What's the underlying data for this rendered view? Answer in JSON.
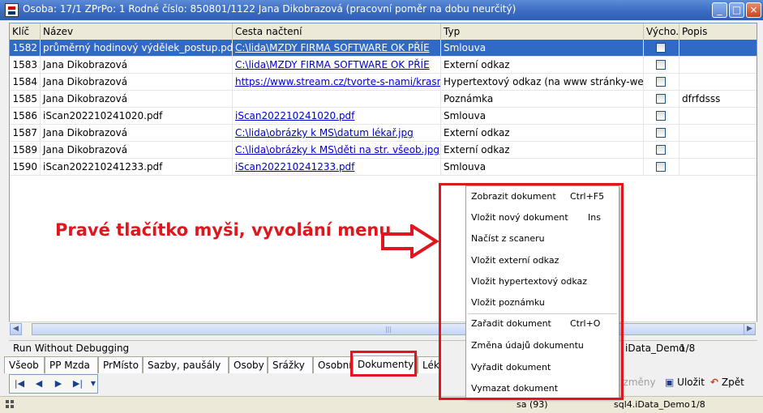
{
  "window": {
    "title": "Osoba: 17/1   ZPrPo: 1   Rodné číslo: 850801/1122   Jana Dikobrazová   (pracovní poměr na dobu neurčitý)",
    "minimize": "_",
    "maximize": "□",
    "close": "×"
  },
  "grid": {
    "columns": [
      "Klíč",
      "Název",
      "Cesta načtení",
      "Typ",
      "Výcho.",
      "Popis"
    ],
    "rows": [
      {
        "key": "1582",
        "name": "průměrný hodinový výdělek_postup.pdf",
        "path": "C:\\lida\\MZDY FIRMA SOFTWARE OK PŘÍE",
        "type": "Smlouva",
        "desc": ""
      },
      {
        "key": "1583",
        "name": "Jana Dikobrazová",
        "path": "C:\\lida\\MZDY FIRMA SOFTWARE OK PŘÍE",
        "type": "Externí odkaz",
        "desc": ""
      },
      {
        "key": "1584",
        "name": "Jana Dikobrazová",
        "path": "https://www.stream.cz/tvorte-s-nami/krasny-",
        "type": "Hypertextový odkaz (na www stránky-web)",
        "desc": ""
      },
      {
        "key": "1585",
        "name": "Jana Dikobrazová",
        "path": "",
        "type": "Poznámka",
        "desc": "dfrfdsss"
      },
      {
        "key": "1586",
        "name": "iScan202210241020.pdf",
        "path": "iScan202210241020.pdf",
        "type": "Smlouva",
        "desc": ""
      },
      {
        "key": "1587",
        "name": "Jana Dikobrazová",
        "path": "C:\\lida\\obrázky k MS\\datum lékař.jpg",
        "type": "Externí odkaz",
        "desc": ""
      },
      {
        "key": "1589",
        "name": "Jana Dikobrazová",
        "path": "C:\\lida\\obrázky k MS\\děti na str. všeob.jpg",
        "type": "Externí odkaz",
        "desc": ""
      },
      {
        "key": "1590",
        "name": "iScan202210241233.pdf",
        "path": "iScan202210241233.pdf",
        "type": "Smlouva",
        "desc": ""
      }
    ]
  },
  "status": {
    "text": "Run Without Debugging",
    "db": "iData_Demo",
    "page": "1/8"
  },
  "tabs": [
    "Všeob",
    "PP Mzda",
    "PrMísto",
    "Sazby, paušály",
    "Osoby",
    "Srážky",
    "Osobní",
    "Dokumenty",
    "Lék"
  ],
  "active_tab": "Dokumenty",
  "toolbar": {
    "changes": "t změny",
    "save": "Uložit",
    "back": "Zpět"
  },
  "bottom_status": {
    "sa": "sa (93)",
    "db": "sql4.iData_Demo",
    "page": "1/8"
  },
  "annotation": "Pravé tlačítko myši, vyvolání menu",
  "context_menu": [
    {
      "label": "Zobrazit dokument",
      "shortcut": "Ctrl+F5"
    },
    {
      "label": "Vložit nový dokument",
      "shortcut": "Ins"
    },
    {
      "label": "Načíst z scaneru",
      "shortcut": ""
    },
    {
      "label": "Vložit externí odkaz",
      "shortcut": ""
    },
    {
      "label": "Vložit hypertextový odkaz",
      "shortcut": ""
    },
    {
      "label": "Vložit poznámku",
      "shortcut": ""
    },
    {
      "label": "Zařadit dokument",
      "shortcut": "Ctrl+O"
    },
    {
      "label": "Změna údajů dokumentu",
      "shortcut": ""
    },
    {
      "label": "Vyřadit dokument",
      "shortcut": ""
    },
    {
      "label": "Vymazat dokument",
      "shortcut": ""
    }
  ],
  "colors": {
    "selection": "#316ac5",
    "annotation": "#e0161e",
    "link": "#0000cc"
  }
}
